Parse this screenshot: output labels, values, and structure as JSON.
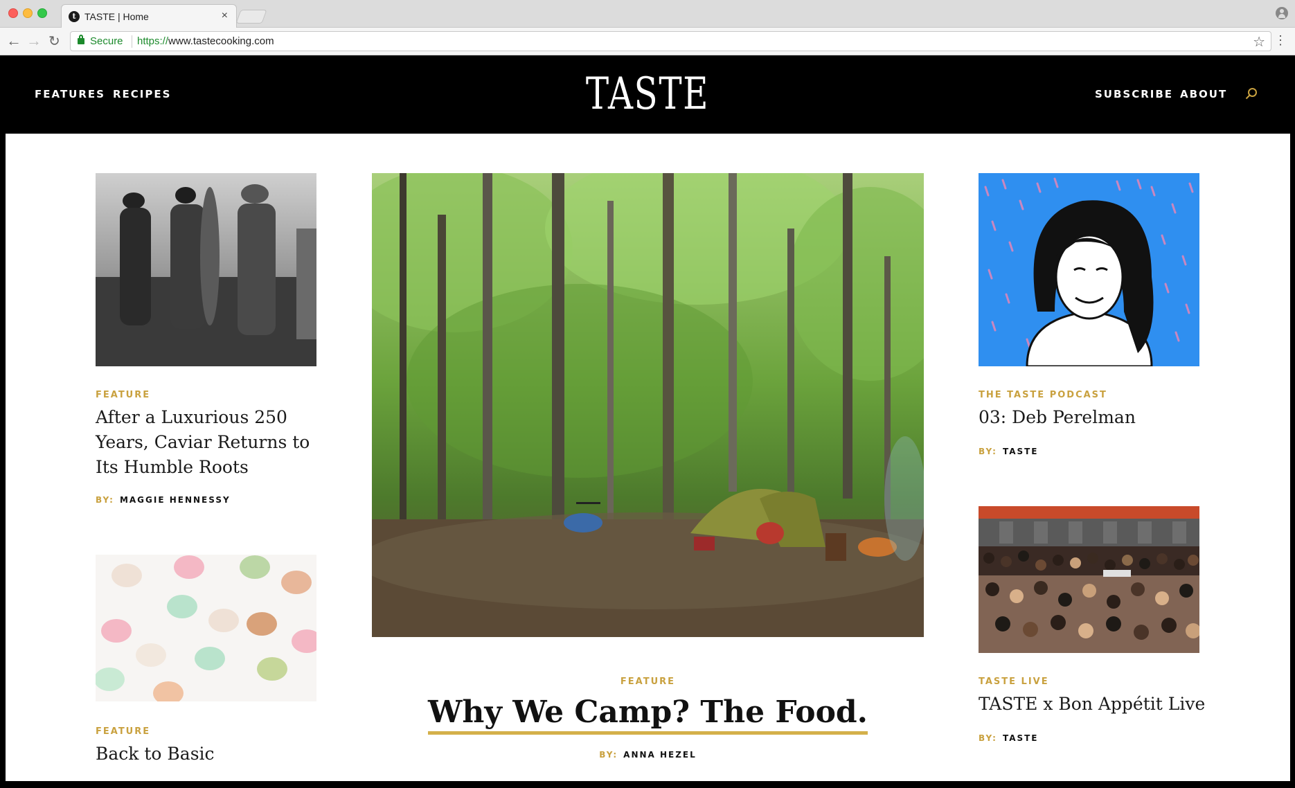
{
  "browser": {
    "tab_title": "TASTE | Home",
    "tab_favicon": "t",
    "tab_close": "×",
    "secure_label": "Secure",
    "url_protocol": "https://",
    "url_host": "www.tastecooking.com",
    "back_icon": "←",
    "forward_icon": "→",
    "reload_icon": "↻",
    "star_icon": "☆",
    "menu_icon": "⋮"
  },
  "header": {
    "nav_left": [
      "FEATURES",
      "RECIPES"
    ],
    "logo": "TASTE",
    "nav_right": [
      "SUBSCRIBE",
      "ABOUT"
    ],
    "accent_color": "#c9a13f"
  },
  "articles": {
    "left_1": {
      "eyebrow": "FEATURE",
      "title": "After a Luxurious 250 Years, Caviar Returns to Its Humble Roots",
      "by_label": "BY:",
      "author": "MAGGIE HENNESSY"
    },
    "left_2": {
      "eyebrow": "FEATURE",
      "title": "Back to Basic"
    },
    "center": {
      "eyebrow": "FEATURE",
      "title": "Why We Camp? The Food.",
      "by_label": "BY:",
      "author": "ANNA HEZEL"
    },
    "right_1": {
      "eyebrow": "THE TASTE PODCAST",
      "title": "03: Deb Perelman",
      "by_label": "BY:",
      "author": "TASTE"
    },
    "right_2": {
      "eyebrow": "TASTE LIVE",
      "title": "TASTE x Bon Appétit Live",
      "by_label": "BY:",
      "author": "TASTE"
    }
  }
}
